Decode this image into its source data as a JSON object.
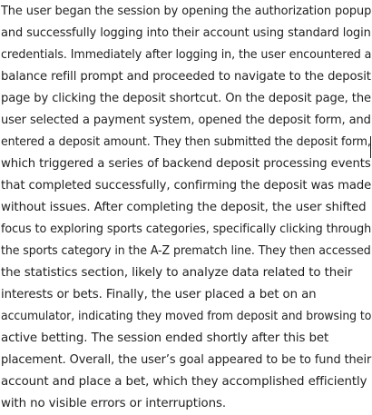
{
  "summary": {
    "lines": [
      "The user began the session by opening the authorization popup",
      "and successfully logging into their account using standard login",
      "credentials. Immediately after logging in, the user encountered a",
      "balance refill prompt and proceeded to navigate to the deposit",
      "page by clicking the deposit shortcut. On the deposit page, the",
      "user selected a payment system, opened the deposit form, and",
      "entered a deposit amount. They then submitted the deposit form,",
      "which triggered a series of backend deposit processing events",
      "that completed successfully, confirming the deposit was made",
      "without issues. After completing the deposit, the user shifted",
      "focus to exploring sports categories, specifically clicking through",
      "the sports category in the A-Z prematch line. They then accessed",
      "the statistics section, likely to analyze data related to their",
      "interests or bets. Finally, the user placed a bet on an",
      "accumulator, indicating they moved from deposit and browsing to",
      "active betting. The session ended shortly after this bet",
      "placement. Overall, the user’s goal appeared to be to fund their",
      "account and place a bet, which they accomplished efficiently",
      "with no visible errors or interruptions."
    ]
  }
}
